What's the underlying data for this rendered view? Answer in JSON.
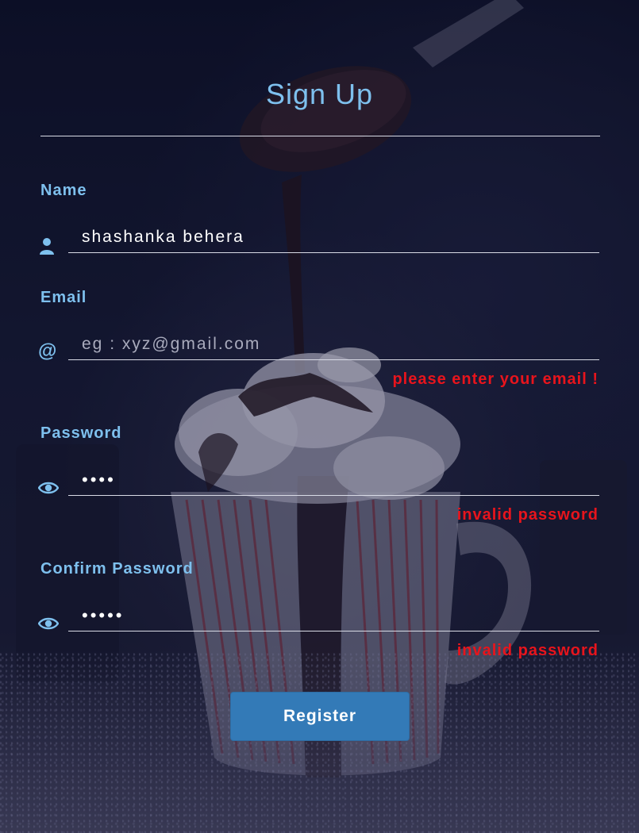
{
  "form": {
    "title": "Sign Up",
    "fields": {
      "name": {
        "label": "Name",
        "icon": "user-icon",
        "value": "shashanka behera",
        "placeholder": ""
      },
      "email": {
        "label": "Email",
        "icon": "at-icon",
        "icon_glyph": "@",
        "value": "",
        "placeholder": "eg : xyz@gmail.com",
        "error": "please enter your email !"
      },
      "password": {
        "label": "Password",
        "icon": "eye-icon",
        "value": "1234",
        "error": "invalid password"
      },
      "confirm_password": {
        "label": "Confirm Password",
        "icon": "eye-icon",
        "value": "12345",
        "error": "invalid password"
      }
    },
    "register_label": "Register"
  },
  "colors": {
    "accent": "#7ec0ee",
    "error": "#e8141c",
    "button": "#337ab7"
  }
}
